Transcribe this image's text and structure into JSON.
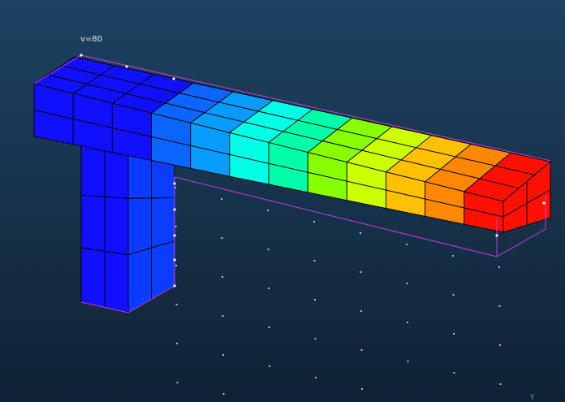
{
  "viewport": {
    "label": "v=80",
    "axis_label": "Y"
  },
  "colors": {
    "background_top": "#1e4262",
    "background_bottom": "#0f2234",
    "wireframe": "#c83ce0",
    "mesh_lines": "#000000",
    "grid_points": "#d8d8d8",
    "contour": [
      "#1010ff",
      "#0c3cff",
      "#0a66ff",
      "#089cff",
      "#00d4ff",
      "#00ffe6",
      "#00ffa8",
      "#22ff44",
      "#88ff00",
      "#ccff00",
      "#fff000",
      "#ffc000",
      "#ff8800",
      "#ff5000",
      "#ff1000"
    ]
  },
  "objects": [
    "beam-mesh",
    "column-mesh",
    "undeformed-wireframe",
    "grid-points"
  ]
}
